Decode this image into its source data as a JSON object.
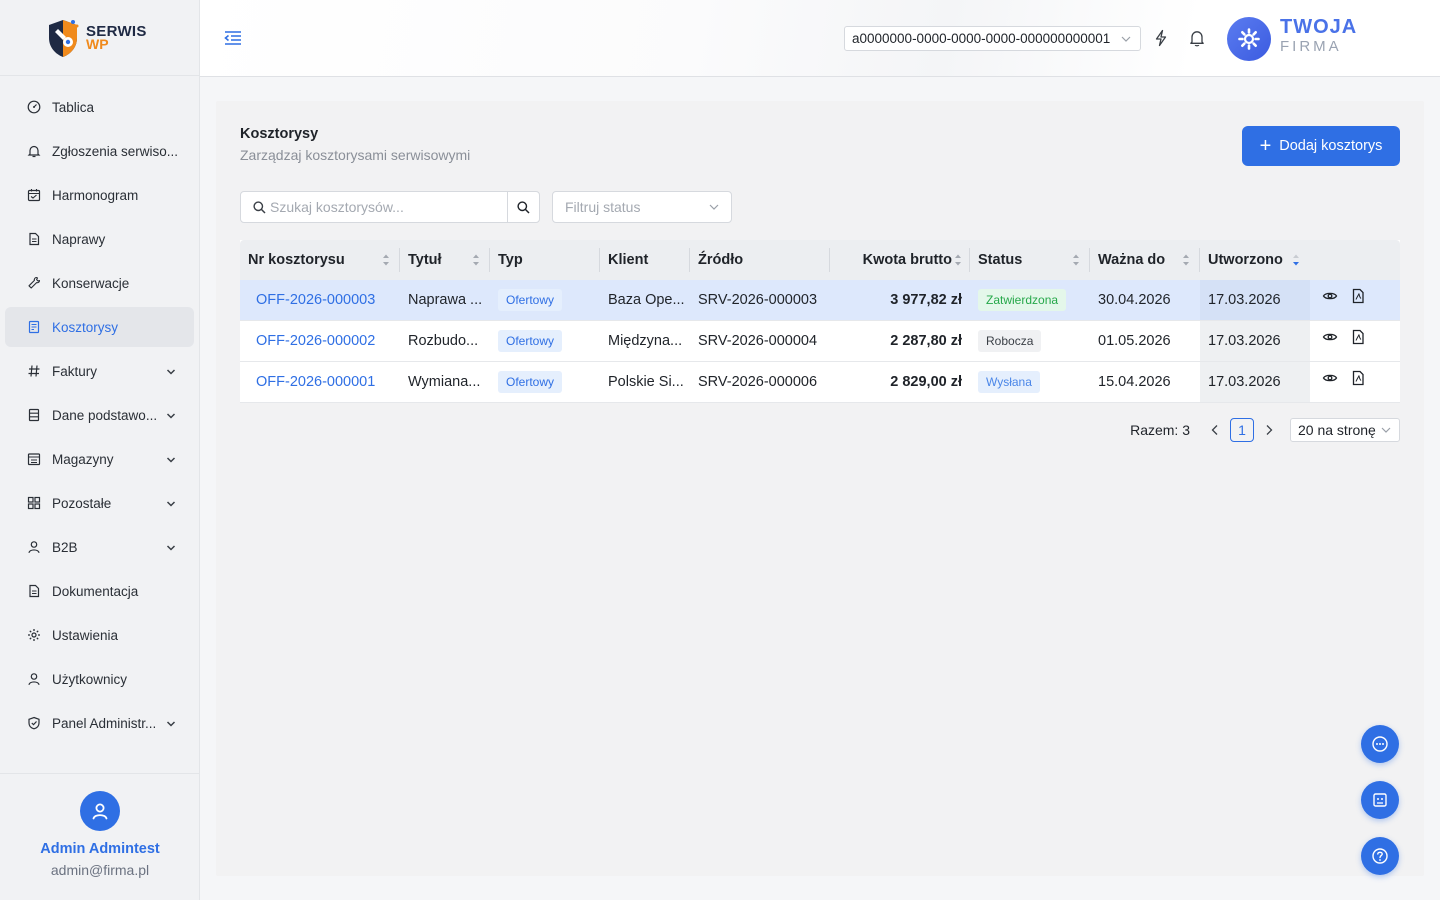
{
  "brand": {
    "line1": "SERWIS",
    "line2": "WP"
  },
  "sidebar": {
    "items": [
      {
        "label": "Tablica",
        "icon": "dashboard-icon",
        "expandable": false
      },
      {
        "label": "Zgłoszenia serwiso...",
        "icon": "bell-icon",
        "expandable": false
      },
      {
        "label": "Harmonogram",
        "icon": "calendar-icon",
        "expandable": false
      },
      {
        "label": "Naprawy",
        "icon": "document-icon",
        "expandable": false
      },
      {
        "label": "Konserwacje",
        "icon": "wrench-icon",
        "expandable": false
      },
      {
        "label": "Kosztorysy",
        "icon": "estimate-icon",
        "expandable": false,
        "active": true
      },
      {
        "label": "Faktury",
        "icon": "hash-icon",
        "expandable": true
      },
      {
        "label": "Dane podstawo...",
        "icon": "database-icon",
        "expandable": true
      },
      {
        "label": "Magazyny",
        "icon": "warehouse-icon",
        "expandable": true
      },
      {
        "label": "Pozostałe",
        "icon": "grid-icon",
        "expandable": true
      },
      {
        "label": "B2B",
        "icon": "user-icon",
        "expandable": true
      },
      {
        "label": "Dokumentacja",
        "icon": "document-icon",
        "expandable": false
      },
      {
        "label": "Ustawienia",
        "icon": "gear-icon",
        "expandable": false
      },
      {
        "label": "Użytkownicy",
        "icon": "user-icon",
        "expandable": false
      },
      {
        "label": "Panel Administr...",
        "icon": "shield-icon",
        "expandable": true
      }
    ]
  },
  "user": {
    "name": "Admin Admintest",
    "email": "admin@firma.pl"
  },
  "header": {
    "tenant_id": "a0000000-0000-0000-0000-000000000001",
    "company_line1": "TWOJA",
    "company_line2": "FIRMA"
  },
  "page": {
    "title": "Kosztorysy",
    "subtitle": "Zarządzaj kosztorysami serwisowymi",
    "add_button": "Dodaj kosztorys",
    "search_placeholder": "Szukaj kosztorysów...",
    "filter_placeholder": "Filtruj status"
  },
  "table": {
    "columns": [
      "Nr kosztorysu",
      "Tytuł",
      "Typ",
      "Klient",
      "Źródło",
      "Kwota brutto",
      "Status",
      "Ważna do",
      "Utworzono"
    ],
    "rows": [
      {
        "nr": "OFF-2026-000003",
        "title": "Naprawa ...",
        "type": "Ofertowy",
        "client": "Baza Ope...",
        "source": "SRV-2026-000003",
        "amount": "3 977,82 zł",
        "status": "Zatwierdzona",
        "status_kind": "green",
        "valid": "30.04.2026",
        "created": "17.03.2026",
        "selected": true
      },
      {
        "nr": "OFF-2026-000002",
        "title": "Rozbudo...",
        "type": "Ofertowy",
        "client": "Międzyna...",
        "source": "SRV-2026-000004",
        "amount": "2 287,80 zł",
        "status": "Robocza",
        "status_kind": "gray",
        "valid": "01.05.2026",
        "created": "17.03.2026",
        "selected": false
      },
      {
        "nr": "OFF-2026-000001",
        "title": "Wymiana...",
        "type": "Ofertowy",
        "client": "Polskie Si...",
        "source": "SRV-2026-000006",
        "amount": "2 829,00 zł",
        "status": "Wysłana",
        "status_kind": "lblue",
        "valid": "15.04.2026",
        "created": "17.03.2026",
        "selected": false
      }
    ]
  },
  "pagination": {
    "total_label": "Razem: 3",
    "current_page": "1",
    "page_size": "20 na stronę"
  },
  "colors": {
    "accent": "#2f6fe4",
    "brand_orange": "#f08a1c",
    "success": "#26a84a"
  }
}
